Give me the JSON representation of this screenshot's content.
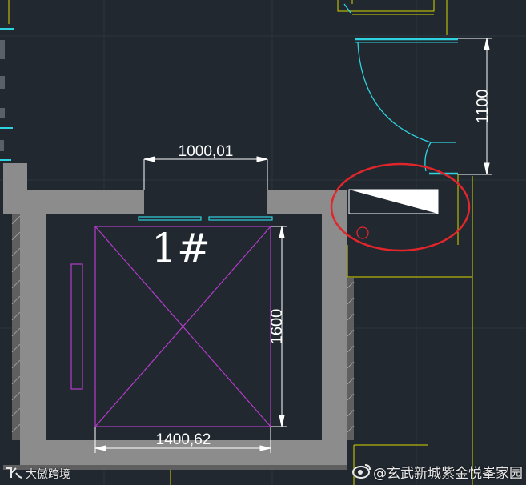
{
  "drawing": {
    "top_dimension": "1000,01",
    "right_dimension": "1100",
    "car_height_dimension": "1600",
    "car_width_dimension": "1400,62",
    "elevator_label": "1#"
  },
  "watermarks": {
    "bottom_left": "大傲跨境",
    "bottom_right": "@玄武新城紫金悦峯家园",
    "weibo_icon": "weibo-icon"
  },
  "colors": {
    "background": "#212830",
    "wall": "#8c8c8c",
    "dimension": "#ffffff",
    "cyan": "#2fd3e0",
    "magenta": "#b43ccc",
    "yellow": "#d8d400",
    "highlight": "#e0262b"
  }
}
